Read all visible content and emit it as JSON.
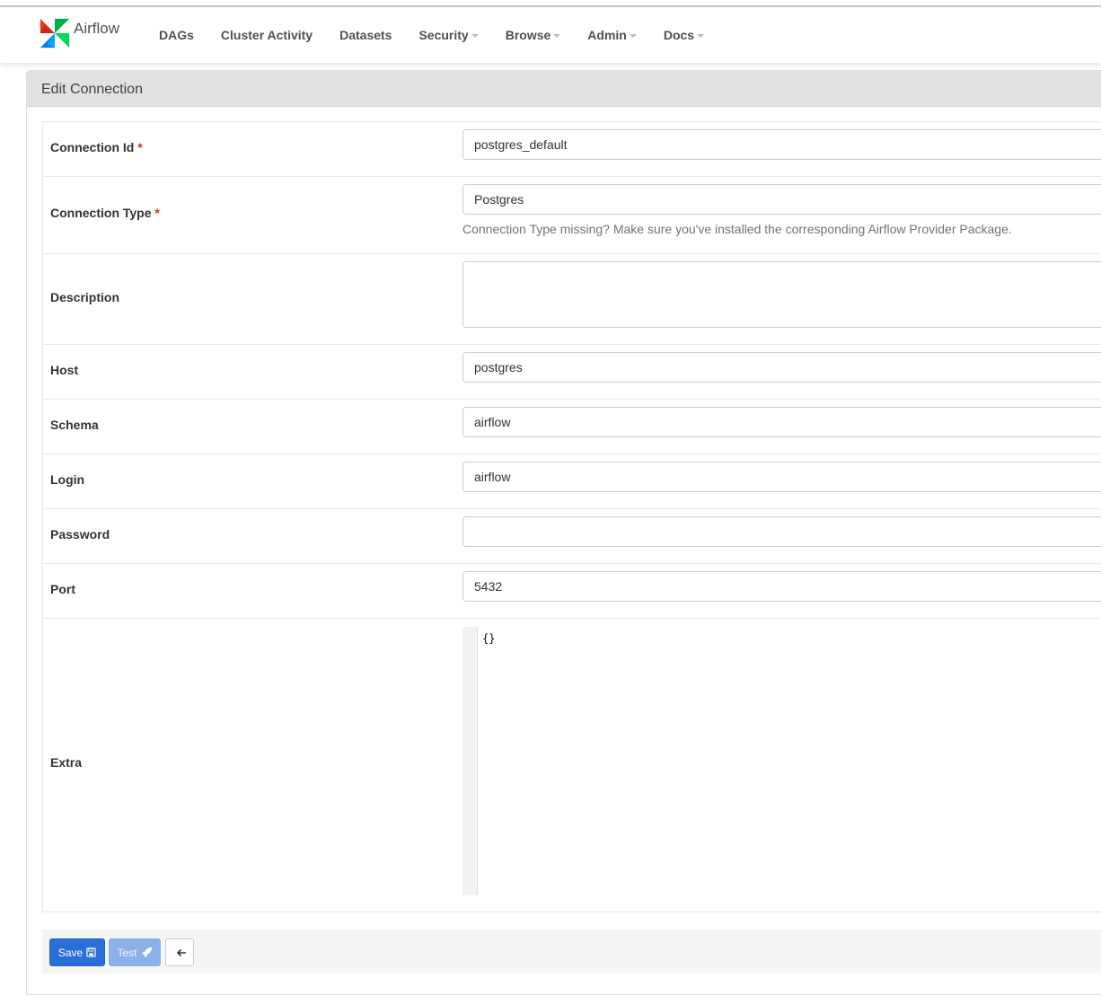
{
  "brand": {
    "name": "Airflow",
    "logo_icon": "airflow-pinwheel-icon"
  },
  "nav": {
    "items": [
      {
        "label": "DAGs",
        "dropdown": false
      },
      {
        "label": "Cluster Activity",
        "dropdown": false
      },
      {
        "label": "Datasets",
        "dropdown": false
      },
      {
        "label": "Security",
        "dropdown": true
      },
      {
        "label": "Browse",
        "dropdown": true
      },
      {
        "label": "Admin",
        "dropdown": true
      },
      {
        "label": "Docs",
        "dropdown": true
      }
    ]
  },
  "panel": {
    "title": "Edit Connection"
  },
  "form": {
    "connection_id": {
      "label": "Connection Id",
      "required": "*",
      "value": "postgres_default"
    },
    "connection_type": {
      "label": "Connection Type",
      "required": "*",
      "value": "Postgres",
      "help": "Connection Type missing? Make sure you've installed the corresponding Airflow Provider Package."
    },
    "description": {
      "label": "Description",
      "value": ""
    },
    "host": {
      "label": "Host",
      "value": "postgres"
    },
    "schema": {
      "label": "Schema",
      "value": "airflow"
    },
    "login": {
      "label": "Login",
      "value": "airflow"
    },
    "password": {
      "label": "Password",
      "value": ""
    },
    "port": {
      "label": "Port",
      "value": "5432"
    },
    "extra": {
      "label": "Extra",
      "value": "{}"
    }
  },
  "actions": {
    "save_label": "Save",
    "save_icon": "save-floppy-icon",
    "test_label": "Test",
    "test_icon": "rocket-icon",
    "back_icon": "arrow-left-icon"
  },
  "colors": {
    "primary": "#2a6fd7",
    "primary_disabled": "#8cb1ea",
    "required": "#c9302c",
    "heading_bg": "#e2e2e2"
  }
}
